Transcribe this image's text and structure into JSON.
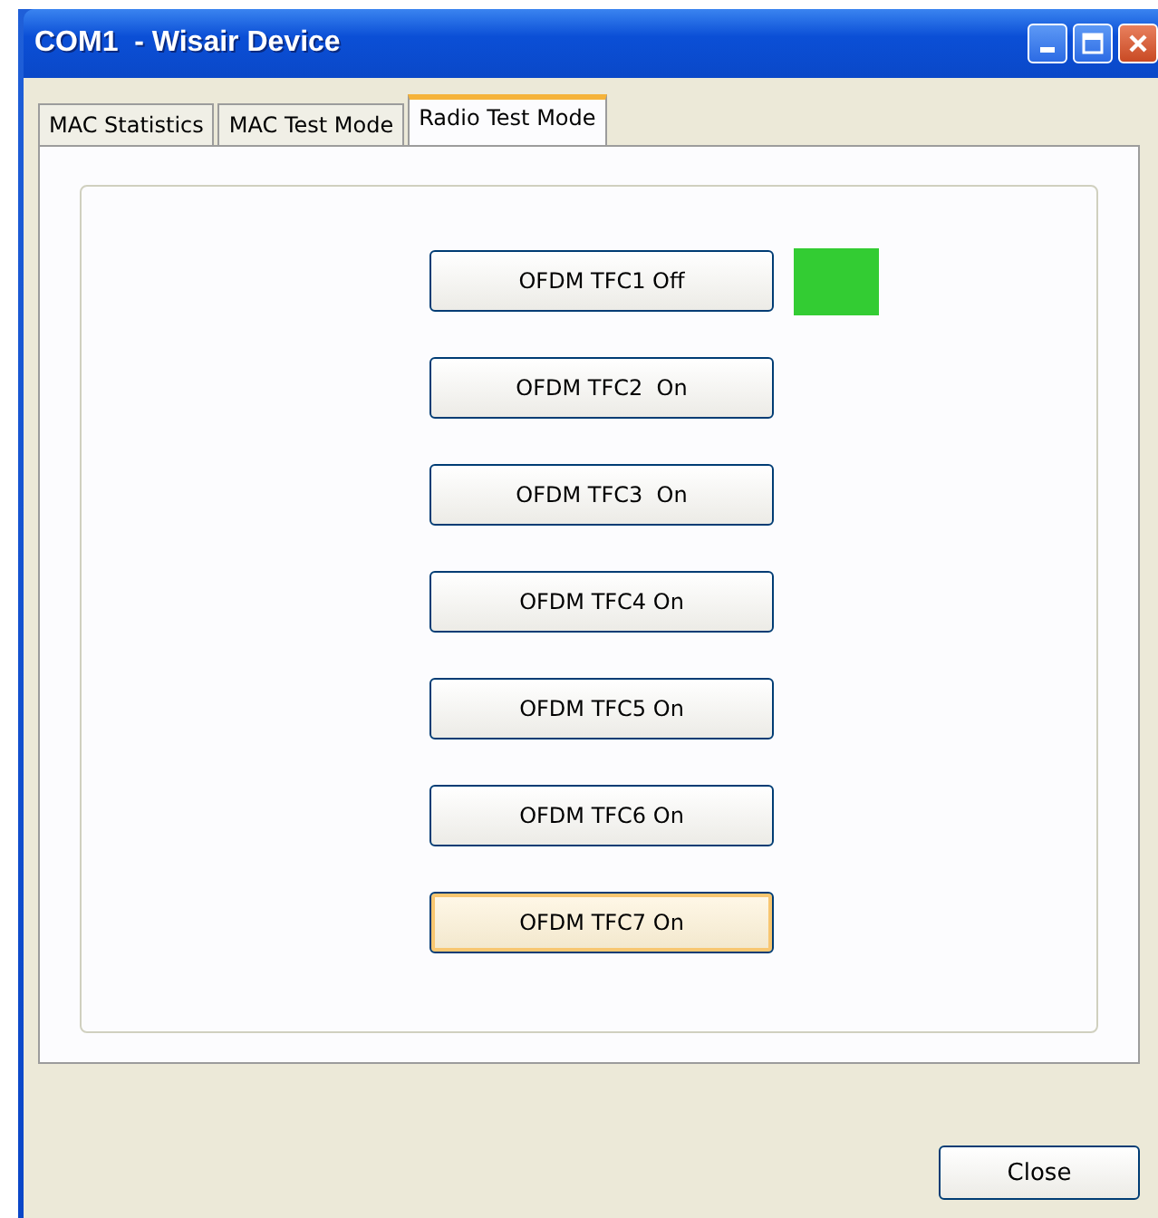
{
  "window": {
    "title": "COM1  - Wisair Device"
  },
  "tabs": [
    {
      "label": "MAC Statistics",
      "selected": false
    },
    {
      "label": "MAC Test Mode",
      "selected": false
    },
    {
      "label": "Radio Test Mode",
      "selected": true
    }
  ],
  "buttons": [
    {
      "label": "OFDM TFC1 Off",
      "focused": false,
      "indicator": true
    },
    {
      "label": "OFDM TFC2  On",
      "focused": false,
      "indicator": false
    },
    {
      "label": "OFDM TFC3  On",
      "focused": false,
      "indicator": false
    },
    {
      "label": "OFDM TFC4 On",
      "focused": false,
      "indicator": false
    },
    {
      "label": "OFDM TFC5 On",
      "focused": false,
      "indicator": false
    },
    {
      "label": "OFDM TFC6 On",
      "focused": false,
      "indicator": false
    },
    {
      "label": "OFDM TFC7 On",
      "focused": true,
      "indicator": false
    }
  ],
  "close_button": "Close"
}
